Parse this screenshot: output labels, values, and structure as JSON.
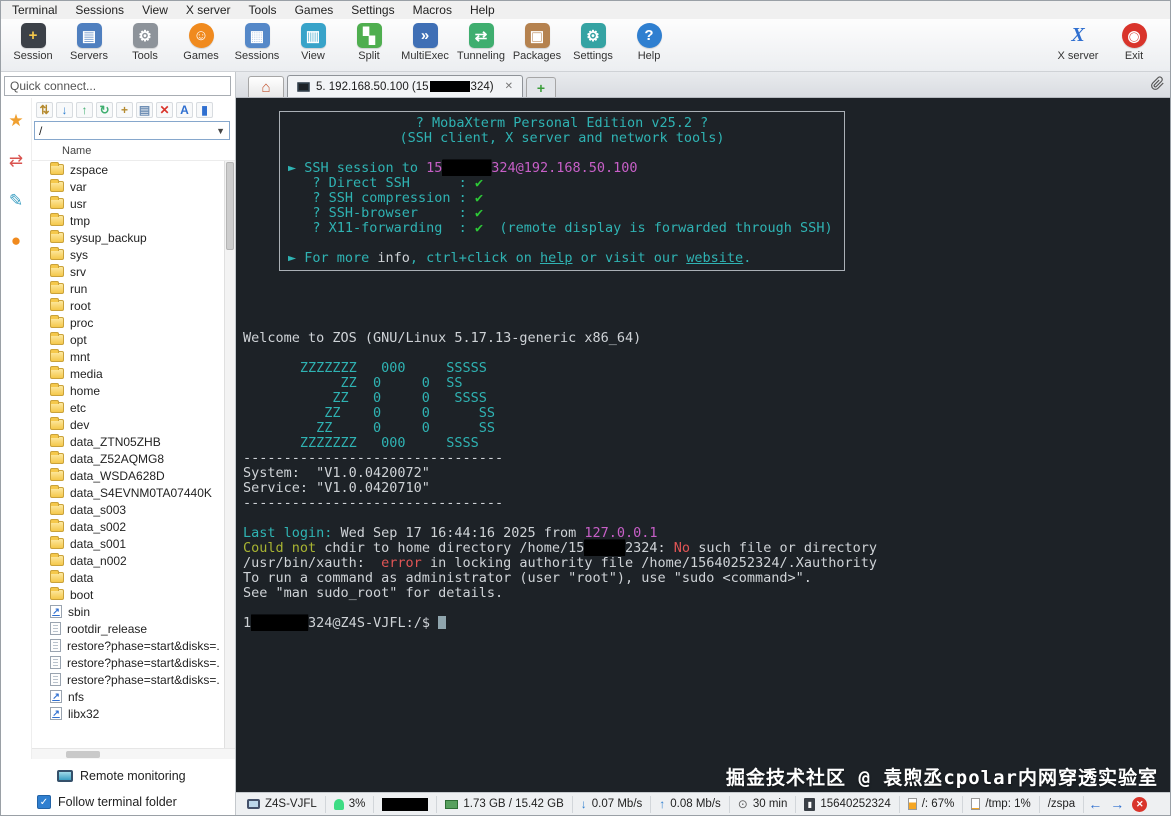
{
  "window": {
    "menu_items": [
      "Terminal",
      "Sessions",
      "View",
      "X server",
      "Tools",
      "Games",
      "Settings",
      "Macros",
      "Help"
    ]
  },
  "toolbar": {
    "buttons": [
      {
        "label": "Session",
        "glyph": "+",
        "bg": "#3c4148",
        "fg": "#f5c84b"
      },
      {
        "label": "Servers",
        "glyph": "▤",
        "bg": "#4f7fbf",
        "fg": "#ffffff"
      },
      {
        "label": "Tools",
        "glyph": "⚙",
        "bg": "#8d939a",
        "fg": "#ffffff"
      },
      {
        "label": "Games",
        "glyph": "☺",
        "bg": "#f08a1e",
        "fg": "#ffffff",
        "round": true
      },
      {
        "label": "Sessions",
        "glyph": "▦",
        "bg": "#5588c8",
        "fg": "#ffffff"
      },
      {
        "label": "View",
        "glyph": "▥",
        "bg": "#38a3c9",
        "fg": "#ffffff"
      },
      {
        "label": "Split",
        "glyph": "▚",
        "bg": "#4fae4f",
        "fg": "#ffffff"
      },
      {
        "label": "MultiExec",
        "glyph": "»",
        "bg": "#3f6fb5",
        "fg": "#ffffff"
      },
      {
        "label": "Tunneling",
        "glyph": "⇄",
        "bg": "#3fae6f",
        "fg": "#ffffff"
      },
      {
        "label": "Packages",
        "glyph": "▣",
        "bg": "#b5824f",
        "fg": "#ffffff"
      },
      {
        "label": "Settings",
        "glyph": "⚙",
        "bg": "#35a3a3",
        "fg": "#ffffff"
      },
      {
        "label": "Help",
        "glyph": "?",
        "bg": "#2f7fd0",
        "fg": "#ffffff",
        "round": true
      }
    ],
    "right_buttons": [
      {
        "label": "X server",
        "glyph": "X",
        "bg": "transparent",
        "fg": "#2f6fd0",
        "xserver": true
      },
      {
        "label": "Exit",
        "glyph": "◉",
        "bg": "#d9342b",
        "fg": "#ffffff",
        "round": true
      }
    ]
  },
  "sidebar": {
    "quick_connect_placeholder": "Quick connect...",
    "side_tabs": [
      {
        "name": "sessions-star-icon",
        "glyph": "★",
        "color": "#f0a030"
      },
      {
        "name": "tools-icon",
        "glyph": "⇄",
        "color": "#d9534f"
      },
      {
        "name": "macros-icon",
        "glyph": "✎",
        "color": "#3a9ec2"
      },
      {
        "name": "sftp-icon",
        "glyph": "●",
        "color": "#f08a1e"
      }
    ],
    "file_toolbar": [
      {
        "name": "sync-browser-icon",
        "glyph": "⇅",
        "color": "#b58a2f"
      },
      {
        "name": "download-icon",
        "glyph": "↓",
        "color": "#2f7fd0"
      },
      {
        "name": "upload-icon",
        "glyph": "↑",
        "color": "#3fae6f"
      },
      {
        "name": "refresh-icon",
        "glyph": "↻",
        "color": "#3fae6f"
      },
      {
        "name": "new-folder-icon",
        "glyph": "+",
        "color": "#b58a2f"
      },
      {
        "name": "new-file-icon",
        "glyph": "▤",
        "color": "#6f8fb5"
      },
      {
        "name": "delete-icon",
        "glyph": "✕",
        "color": "#d9342b"
      },
      {
        "name": "rename-icon",
        "glyph": "A",
        "color": "#2f6fd0"
      },
      {
        "name": "pin-icon",
        "glyph": "▮",
        "color": "#2f6fd0"
      }
    ],
    "path_value": "/",
    "tree_header": "Name",
    "tree_items": [
      {
        "label": "zspace",
        "type": "folder"
      },
      {
        "label": "var",
        "type": "folder"
      },
      {
        "label": "usr",
        "type": "folder"
      },
      {
        "label": "tmp",
        "type": "folder"
      },
      {
        "label": "sysup_backup",
        "type": "folder"
      },
      {
        "label": "sys",
        "type": "folder"
      },
      {
        "label": "srv",
        "type": "folder"
      },
      {
        "label": "run",
        "type": "folder"
      },
      {
        "label": "root",
        "type": "folder"
      },
      {
        "label": "proc",
        "type": "folder"
      },
      {
        "label": "opt",
        "type": "folder"
      },
      {
        "label": "mnt",
        "type": "folder"
      },
      {
        "label": "media",
        "type": "folder"
      },
      {
        "label": "home",
        "type": "folder"
      },
      {
        "label": "etc",
        "type": "folder"
      },
      {
        "label": "dev",
        "type": "folder"
      },
      {
        "label": "data_ZTN05ZHB",
        "type": "folder"
      },
      {
        "label": "data_Z52AQMG8",
        "type": "folder"
      },
      {
        "label": "data_WSDA628D",
        "type": "folder"
      },
      {
        "label": "data_S4EVNM0TA07440K",
        "type": "folder"
      },
      {
        "label": "data_s003",
        "type": "folder"
      },
      {
        "label": "data_s002",
        "type": "folder"
      },
      {
        "label": "data_s001",
        "type": "folder"
      },
      {
        "label": "data_n002",
        "type": "folder"
      },
      {
        "label": "data",
        "type": "folder"
      },
      {
        "label": "boot",
        "type": "folder"
      },
      {
        "label": "sbin",
        "type": "link"
      },
      {
        "label": "rootdir_release",
        "type": "file"
      },
      {
        "label": "restore?phase=start&disks=.",
        "type": "file"
      },
      {
        "label": "restore?phase=start&disks=.",
        "type": "file"
      },
      {
        "label": "restore?phase=start&disks=.",
        "type": "file"
      },
      {
        "label": "nfs",
        "type": "link"
      },
      {
        "label": "libx32",
        "type": "link"
      }
    ],
    "remote_monitoring_label": "Remote monitoring",
    "follow_terminal_label": "Follow terminal folder"
  },
  "tabs": {
    "active": {
      "prefix": "5. 192.168.50.100 (15",
      "suffix": "324)"
    }
  },
  "terminal": {
    "banner_lines": [
      {
        "center": true,
        "seg": [
          {
            "t": "? MobaXterm Personal Edition v25.2 ?",
            "c": "cyan"
          }
        ]
      },
      {
        "center": true,
        "seg": [
          {
            "t": "(SSH client, X server and network tools)",
            "c": "cyan"
          }
        ]
      },
      {
        "seg": []
      },
      {
        "seg": [
          {
            "t": "► SSH session to ",
            "c": "cyan"
          },
          {
            "t": "15",
            "c": "magenta"
          },
          {
            "t": "██████",
            "c": "redact"
          },
          {
            "t": "324@192.168.50.100",
            "c": "magenta"
          }
        ]
      },
      {
        "seg": [
          {
            "t": "   ? Direct SSH      : ",
            "c": "cyan"
          },
          {
            "t": "✔",
            "c": "green"
          }
        ]
      },
      {
        "seg": [
          {
            "t": "   ? SSH compression : ",
            "c": "cyan"
          },
          {
            "t": "✔",
            "c": "green"
          }
        ]
      },
      {
        "seg": [
          {
            "t": "   ? SSH-browser     : ",
            "c": "cyan"
          },
          {
            "t": "✔",
            "c": "green"
          }
        ]
      },
      {
        "seg": [
          {
            "t": "   ? X11-forwarding  : ",
            "c": "cyan"
          },
          {
            "t": "✔",
            "c": "green"
          },
          {
            "t": "  (remote display is forwarded through SSH)",
            "c": "cyan"
          }
        ]
      },
      {
        "seg": []
      },
      {
        "seg": [
          {
            "t": "► For more ",
            "c": "cyan"
          },
          {
            "t": "info",
            "c": "white"
          },
          {
            "t": ", ctrl+click on ",
            "c": "cyan"
          },
          {
            "t": "help",
            "c": "link"
          },
          {
            "t": " or visit our ",
            "c": "cyan"
          },
          {
            "t": "website",
            "c": "link"
          },
          {
            "t": ".",
            "c": "cyan"
          }
        ]
      }
    ],
    "lines": [
      {
        "seg": []
      },
      {
        "seg": []
      },
      {
        "seg": []
      },
      {
        "seg": []
      },
      {
        "seg": [
          {
            "t": "Welcome to ZOS (GNU/Linux 5.17.13-generic x86_64)",
            "c": "white"
          }
        ]
      },
      {
        "seg": []
      },
      {
        "seg": [
          {
            "t": "       ZZZZZZZ   000     SSSSS",
            "c": "cyan"
          }
        ]
      },
      {
        "seg": [
          {
            "t": "            ZZ  0     0  SS",
            "c": "cyan"
          }
        ]
      },
      {
        "seg": [
          {
            "t": "           ZZ   0     0   SSSS",
            "c": "cyan"
          }
        ]
      },
      {
        "seg": [
          {
            "t": "          ZZ    0     0      SS",
            "c": "cyan"
          }
        ]
      },
      {
        "seg": [
          {
            "t": "         ZZ     0     0      SS",
            "c": "cyan"
          }
        ]
      },
      {
        "seg": [
          {
            "t": "       ZZZZZZZ   000     SSSS",
            "c": "cyan"
          }
        ]
      },
      {
        "seg": [
          {
            "t": "--------------------------------",
            "c": "white"
          }
        ]
      },
      {
        "seg": [
          {
            "t": "System:  \"V1.0.0420072\"",
            "c": "white"
          }
        ]
      },
      {
        "seg": [
          {
            "t": "Service: \"V1.0.0420710\"",
            "c": "white"
          }
        ]
      },
      {
        "seg": [
          {
            "t": "--------------------------------",
            "c": "white"
          }
        ]
      },
      {
        "seg": []
      },
      {
        "seg": [
          {
            "t": "Last login:",
            "c": "cyan"
          },
          {
            "t": " Wed Sep 17 16:44:16 2025 from ",
            "c": "white"
          },
          {
            "t": "127.0.0.1",
            "c": "magenta"
          }
        ]
      },
      {
        "seg": [
          {
            "t": "Could not",
            "c": "olive"
          },
          {
            "t": " chdir to home directory /home/15",
            "c": "white"
          },
          {
            "t": "█████",
            "c": "redact"
          },
          {
            "t": "2324: ",
            "c": "white"
          },
          {
            "t": "No",
            "c": "red"
          },
          {
            "t": " such file or directory",
            "c": "white"
          }
        ]
      },
      {
        "seg": [
          {
            "t": "/usr/bin/xauth: ",
            "c": "white"
          },
          {
            "t": " error",
            "c": "red"
          },
          {
            "t": " in locking authority file /home/15640252324/.Xauthority",
            "c": "white"
          }
        ]
      },
      {
        "seg": [
          {
            "t": "To run a command as administrator (user \"root\"), use \"sudo <command>\".",
            "c": "white"
          }
        ]
      },
      {
        "seg": [
          {
            "t": "See \"man sudo_root\" for details.",
            "c": "white"
          }
        ]
      },
      {
        "seg": []
      },
      {
        "cursor": true,
        "seg": [
          {
            "t": "1",
            "c": "white"
          },
          {
            "t": "███████",
            "c": "redact"
          },
          {
            "t": "324@Z4S-VJFL:/$ ",
            "c": "white"
          }
        ]
      }
    ]
  },
  "statusbar": {
    "items": [
      {
        "name": "hostname",
        "icon": "monitor",
        "glyph": "",
        "text": "Z4S-VJFL"
      },
      {
        "name": "cpu-usage",
        "icon": "android",
        "glyph": "",
        "text": "3%"
      },
      {
        "name": "redacted-item",
        "icon": "redactbox",
        "glyph": "",
        "text": ""
      },
      {
        "name": "memory-usage",
        "icon": "ram",
        "glyph": "",
        "text": "1.73 GB / 15.42 GB"
      },
      {
        "name": "download-speed",
        "icon": "arrow",
        "glyph": "↓",
        "text": "0.07 Mb/s"
      },
      {
        "name": "upload-speed",
        "icon": "arrow",
        "glyph": "↑",
        "text": "0.08 Mb/s"
      },
      {
        "name": "session-time",
        "icon": "clockg",
        "glyph": "⊙",
        "text": "30 min"
      },
      {
        "name": "user-id",
        "icon": "badge",
        "glyph": "▮",
        "text": "15640252324"
      },
      {
        "name": "disk-root",
        "icon": "gauge",
        "glyph": "",
        "text": "/: 67%"
      },
      {
        "name": "disk-tmp",
        "icon": "gauge2",
        "glyph": "",
        "text": "/tmp: 1%"
      },
      {
        "name": "disk-zspace",
        "icon": "none",
        "glyph": "",
        "text": "/zspa"
      },
      {
        "name": "scroll-left",
        "icon": "navarrow",
        "glyph": "←",
        "text": "",
        "interactable": true
      },
      {
        "name": "scroll-right",
        "icon": "navarrow",
        "glyph": "→",
        "text": "",
        "interactable": true
      },
      {
        "name": "close-terminal",
        "icon": "closebtn",
        "glyph": "✕",
        "text": "",
        "interactable": true
      }
    ]
  },
  "watermark": "掘金技术社区 @ 袁煦丞cpolar内网穿透实验室"
}
